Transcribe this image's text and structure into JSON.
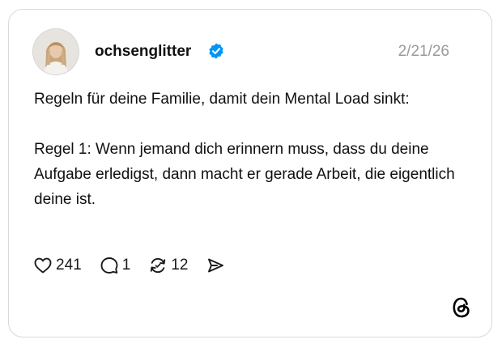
{
  "post": {
    "username": "ochsenglitter",
    "verified": true,
    "date": "2/21/26",
    "paragraphs": [
      "Regeln für deine Familie, damit dein Mental Load sinkt:",
      "Regel 1: Wenn jemand dich erinnern muss, dass du deine Aufgabe erledigst, dann macht er gerade Arbeit, die eigentlich deine ist."
    ]
  },
  "stats": {
    "likes": "241",
    "replies": "1",
    "reposts": "12"
  },
  "icons": {
    "like": "heart-icon",
    "reply": "comment-icon",
    "repost": "repost-icon",
    "share": "send-icon",
    "brand": "threads-logo",
    "verified": "verified-badge-icon"
  },
  "colors": {
    "verified_badge": "#0095f6",
    "date_text": "#9a9a9a",
    "card_border": "#d9d9d9"
  }
}
